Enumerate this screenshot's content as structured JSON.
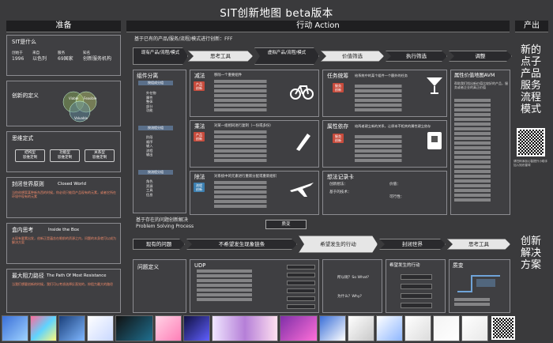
{
  "title": "SIT创新地图  beta版本",
  "headers": {
    "left": "准备",
    "center": "行动 Action",
    "right": "产出"
  },
  "left": {
    "what": {
      "title": "SIT是什么",
      "cols": [
        {
          "a": "创始于",
          "b": "1996"
        },
        {
          "a": "来自",
          "b": "以色列"
        },
        {
          "a": "服务",
          "b": "69国家"
        },
        {
          "a": "知名",
          "b": "创新服务机构"
        }
      ]
    },
    "definition": {
      "title": "创新的定义",
      "venn": [
        "Viable",
        "Feasible",
        "Valuable"
      ]
    },
    "mindset": {
      "title": "思维定式",
      "pills": [
        "结构型\n思维定制",
        "功能型\n思维定制",
        "关系型\n思维定制"
      ]
    },
    "closed": {
      "title": "封闭世界原则",
      "en": "Closed World",
      "desc": "当你创想案某种新东西的时候，你必须只能用产品现有的元素，或者它所在环境中现有的元素"
    },
    "inside": {
      "title": "盒内思考",
      "en": "Inside the Box",
      "desc": "从现有要素出发，创新正是蕴含在眼前的资源之内，问题的本身就可以成为解决方案"
    },
    "resistance": {
      "title": "最大阻力路径",
      "en": "The Path Of Most Resistance",
      "desc": "当我们想要创新的时候，我们可以考虑选择反直觉的，抑阻力最大的路径"
    }
  },
  "action": {
    "intro": "基于已有的产品/服务/流程/模式进行创新：FFF",
    "steps": [
      "现有产品/流程/模式",
      "思考工具",
      "虚拟产品/流程/模式",
      "价值筛选",
      "执行筛选",
      "调整"
    ],
    "components": {
      "title": "组件分离",
      "tag1": "按组成分组",
      "items1": [
        "外在物",
        "属性",
        "整体",
        "部分",
        "功能"
      ],
      "tag2": "按流程分组",
      "items2": [
        "阶段",
        "顺序",
        "输入",
        "流程",
        "输出"
      ],
      "tag3": "按流程分组",
      "items3": [
        "角色",
        "资源",
        "工具",
        "信息"
      ]
    },
    "subtract": {
      "title": "减法",
      "tag": "产品\n创新",
      "heading": "移除一个重要组件"
    },
    "multiply": {
      "title": "乘法",
      "tag": "产品\n创新",
      "heading": "对某一组相同进行复制（一份或多份）"
    },
    "divide": {
      "title": "除法",
      "tag": "流程\n创新",
      "heading": "对系统中的元素进行重新分配或重新组织"
    },
    "unify": {
      "title": "任务统筹",
      "tag": "服务\n创新",
      "heading": "给系统中的某个组件一个额外的任务"
    },
    "dependency": {
      "title": "属性依存",
      "tag": "服务\n创新",
      "heading": "给两者建立新的关系，让原本不相关的属性建立依存"
    },
    "record": {
      "title": "想法记录卡",
      "fields": [
        "创新想法：",
        "基于的技术：",
        "价值：",
        "可行性："
      ]
    },
    "value": {
      "title": "属性价值地图AVM",
      "desc": "帮助我们找出新价值比较好的产品，服务或者企业的真正价值"
    }
  },
  "problem": {
    "intro1": "基于存在的问题创新解决",
    "intro2": "Problem Solving Process",
    "quality": "质变",
    "steps": [
      "现有的问题",
      "不希望发生现象链条",
      "希望发生的行动",
      "封闭世界",
      "思考工具"
    ],
    "define": "问题定义",
    "udp": "UDP",
    "so_what": "所以呢？So What?",
    "why": "为什么？Why?",
    "expected": "希望发生的行动",
    "quality2": "质变"
  },
  "outputs": {
    "top": "新的\n点子\n产品\n服务\n流程\n模式",
    "bottom": "创新\n解决\n方案",
    "qr_caption": "请扫码添加心智提升小助手\n加入知识星球"
  }
}
